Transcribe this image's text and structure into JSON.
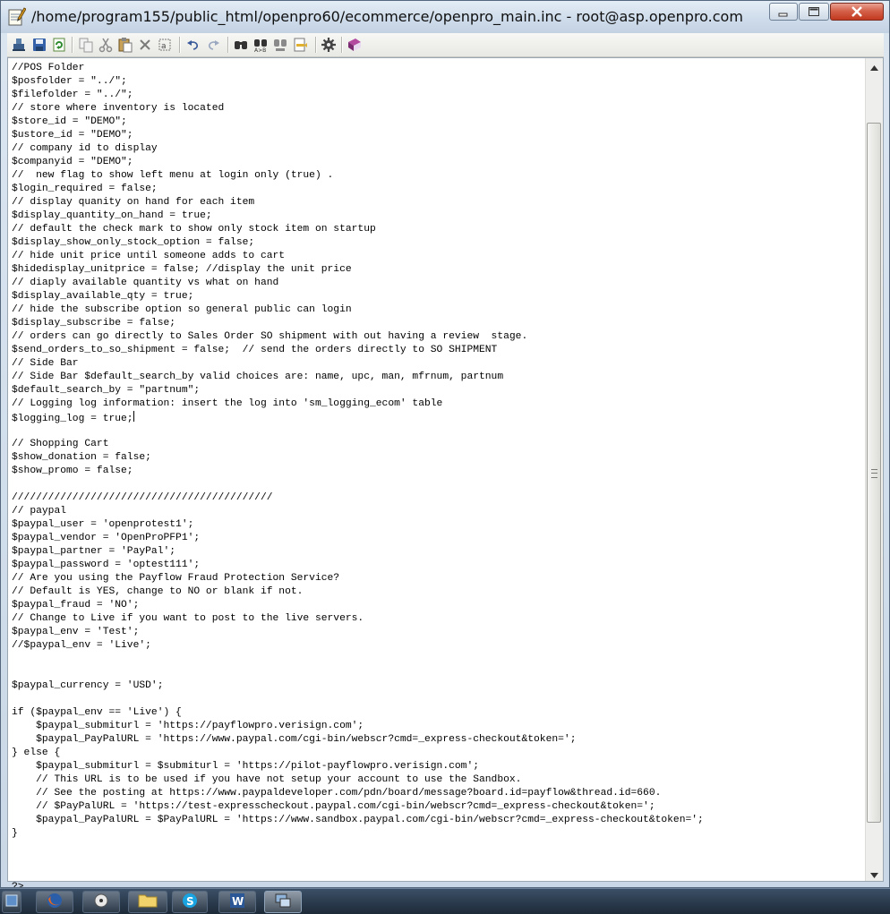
{
  "window": {
    "title": "/home/program155/public_html/openpro60/ecommerce/openpro_main.inc - root@asp.openpro.com",
    "controls": {
      "minimize": "minimize-icon",
      "maximize": "maximize-icon",
      "close": "close-icon"
    }
  },
  "toolbar": {
    "icons": [
      "connect-icon",
      "save-icon",
      "refresh-icon",
      "copy-icon",
      "cut-icon",
      "paste-icon",
      "delete-icon",
      "select-all-icon",
      "undo-icon",
      "redo-icon",
      "find-icon",
      "find-next-icon",
      "replace-icon",
      "goto-line-icon",
      "settings-icon",
      "help-book-icon"
    ]
  },
  "editor": {
    "lines": [
      "//POS Folder",
      "$posfolder = \"../\";",
      "$filefolder = \"../\";",
      "// store where inventory is located",
      "$store_id = \"DEMO\";",
      "$ustore_id = \"DEMO\";",
      "// company id to display",
      "$companyid = \"DEMO\";",
      "//  new flag to show left menu at login only (true) .",
      "$login_required = false;",
      "// display quanity on hand for each item",
      "$display_quantity_on_hand = true;",
      "// default the check mark to show only stock item on startup",
      "$display_show_only_stock_option = false;",
      "// hide unit price until someone adds to cart",
      "$hidedisplay_unitprice = false; //display the unit price",
      "// diaply available quantity vs what on hand",
      "$display_available_qty = true;",
      "// hide the subscribe option so general public can login",
      "$display_subscribe = false;",
      "// orders can go directly to Sales Order SO shipment with out having a review  stage.",
      "$send_orders_to_so_shipment = false;  // send the orders directly to SO SHIPMENT",
      "// Side Bar",
      "// Side Bar $default_search_by valid choices are: name, upc, man, mfrnum, partnum",
      "$default_search_by = \"partnum\";",
      "// Logging log information: insert the log into 'sm_logging_ecom' table",
      "$logging_log = true;",
      "",
      "// Shopping Cart",
      "$show_donation = false;",
      "$show_promo = false;",
      "",
      "///////////////////////////////////////////",
      "// paypal",
      "$paypal_user = 'openprotest1';",
      "$paypal_vendor = 'OpenProPFP1';",
      "$paypal_partner = 'PayPal';",
      "$paypal_password = 'optest111';",
      "// Are you using the Payflow Fraud Protection Service?",
      "// Default is YES, change to NO or blank if not.",
      "$paypal_fraud = 'NO';",
      "// Change to Live if you want to post to the live servers.",
      "$paypal_env = 'Test';",
      "//$paypal_env = 'Live';",
      "",
      "",
      "$paypal_currency = 'USD';",
      "",
      "if ($paypal_env == 'Live') {",
      "    $paypal_submiturl = 'https://payflowpro.verisign.com';",
      "    $paypal_PayPalURL = 'https://www.paypal.com/cgi-bin/webscr?cmd=_express-checkout&token=';",
      "} else {",
      "    $paypal_submiturl = $submiturl = 'https://pilot-payflowpro.verisign.com';",
      "    // This URL is to be used if you have not setup your account to use the Sandbox.",
      "    // See the posting at https://www.paypaldeveloper.com/pdn/board/message?board.id=payflow&thread.id=660.",
      "    // $PayPalURL = 'https://test-expresscheckout.paypal.com/cgi-bin/webscr?cmd=_express-checkout&token=';",
      "    $paypal_PayPalURL = $PayPalURL = 'https://www.sandbox.paypal.com/cgi-bin/webscr?cmd=_express-checkout&token=';",
      "}",
      "",
      "",
      "",
      "?>"
    ],
    "caret_line": 26
  },
  "taskbar": {
    "items": [
      "start-icon",
      "firefox-icon",
      "media-center-icon",
      "explorer-folder-icon",
      "skype-icon",
      "word-icon",
      "remote-desktop-icon"
    ]
  }
}
